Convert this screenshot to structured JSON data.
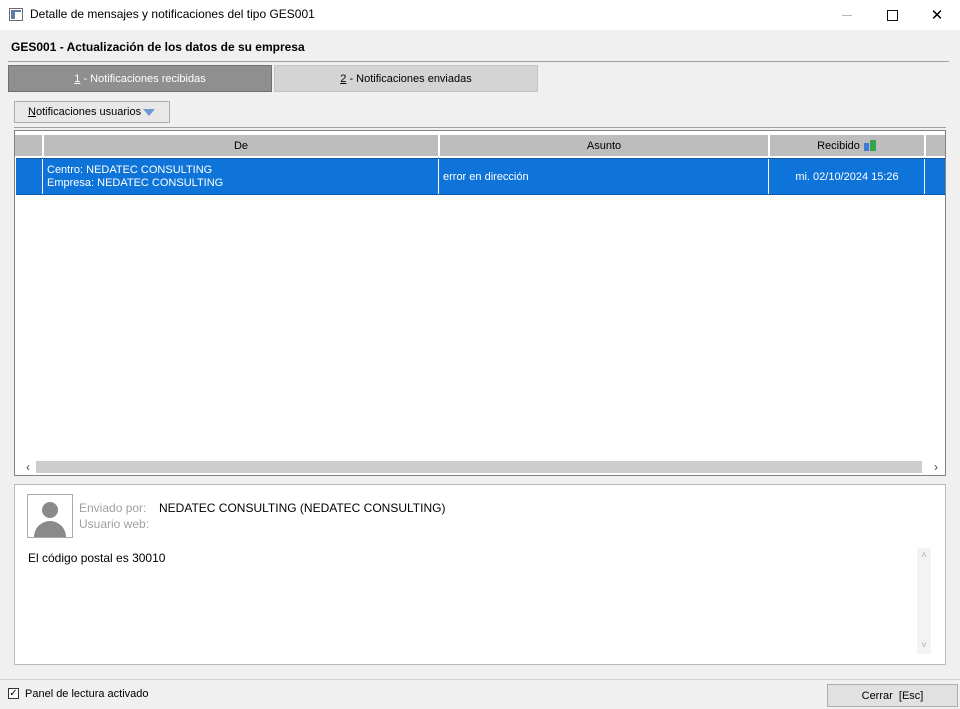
{
  "window": {
    "title": "Detalle de mensajes y notificaciones del tipo GES001",
    "close_glyph": "✕"
  },
  "form": {
    "heading": "GES001 - Actualización de los datos de su empresa"
  },
  "tabs": [
    {
      "number": "1",
      "label": " - Notificaciones recibidas",
      "active": true
    },
    {
      "number": "2",
      "label": " - Notificaciones enviadas",
      "active": false
    }
  ],
  "filter": {
    "first_letter": "N",
    "rest": "otificaciones usuarios"
  },
  "grid": {
    "columns": [
      "",
      "De",
      "Asunto",
      "Recibido"
    ],
    "rows": [
      {
        "de_line1": "Centro: NEDATEC CONSULTING",
        "de_line2": "Empresa: NEDATEC CONSULTING",
        "asunto": "error en dirección",
        "recibido": "mi. 02/10/2024 15:26",
        "selected": true
      }
    ],
    "selection_color": "#0e74d9"
  },
  "scroll": {
    "left_glyph": "‹",
    "right_glyph": "›",
    "up_glyph": "˄",
    "down_glyph": "˅"
  },
  "preview": {
    "sent_by_label": "Enviado por:",
    "sent_by_value": "NEDATEC CONSULTING (NEDATEC CONSULTING)",
    "web_user_label": "Usuario web:",
    "body": "El código postal es 30010"
  },
  "footer": {
    "reading_panel_label": "Panel de lectura activado",
    "reading_panel_checked": true,
    "check_glyph": "✓",
    "close_button_label": "Cerrar  [Esc]"
  }
}
